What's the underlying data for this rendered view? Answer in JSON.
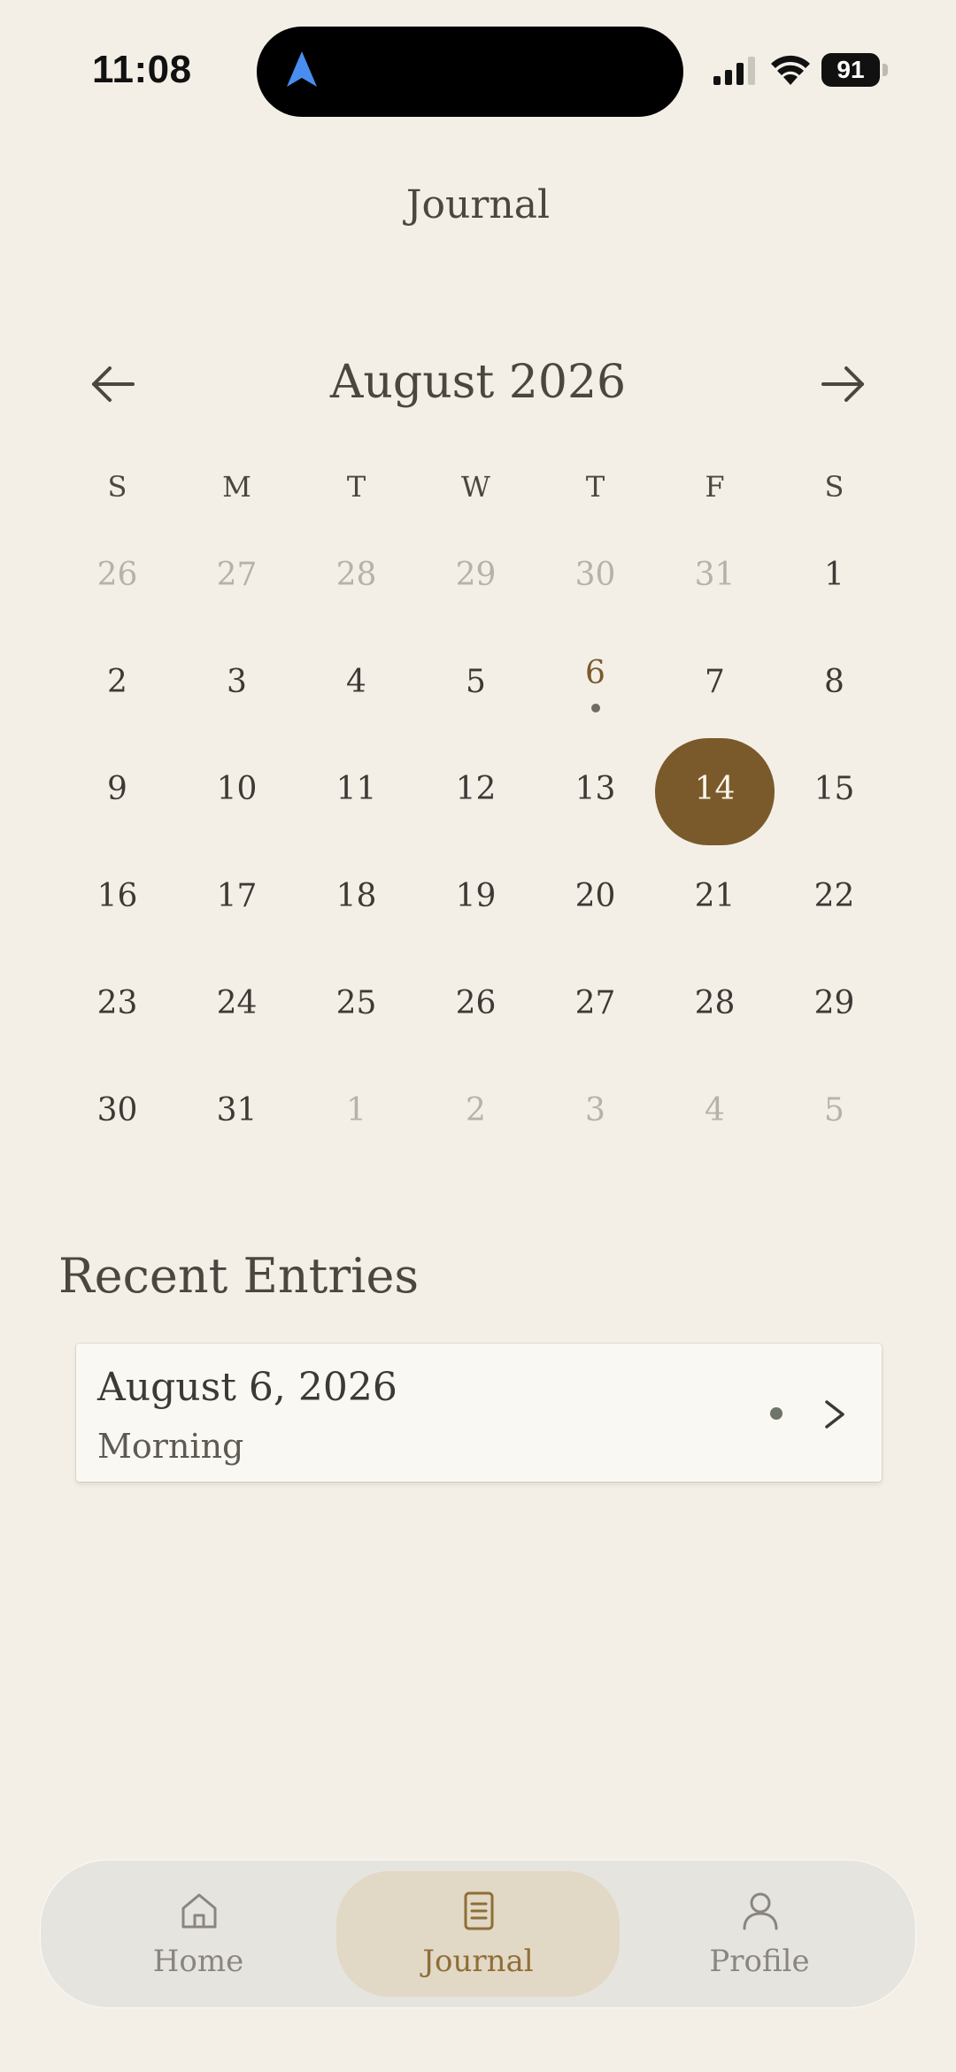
{
  "status_bar": {
    "time": "11:08",
    "battery": "91"
  },
  "header": {
    "title": "Journal"
  },
  "calendar": {
    "month_label": "August 2026",
    "weekdays": [
      "S",
      "M",
      "T",
      "W",
      "T",
      "F",
      "S"
    ],
    "days": [
      {
        "label": "26",
        "muted": true
      },
      {
        "label": "27",
        "muted": true
      },
      {
        "label": "28",
        "muted": true
      },
      {
        "label": "29",
        "muted": true
      },
      {
        "label": "30",
        "muted": true
      },
      {
        "label": "31",
        "muted": true
      },
      {
        "label": "1"
      },
      {
        "label": "2"
      },
      {
        "label": "3"
      },
      {
        "label": "4"
      },
      {
        "label": "5"
      },
      {
        "label": "6",
        "has_entry": true
      },
      {
        "label": "7"
      },
      {
        "label": "8"
      },
      {
        "label": "9"
      },
      {
        "label": "10"
      },
      {
        "label": "11"
      },
      {
        "label": "12"
      },
      {
        "label": "13"
      },
      {
        "label": "14",
        "selected": true
      },
      {
        "label": "15"
      },
      {
        "label": "16"
      },
      {
        "label": "17"
      },
      {
        "label": "18"
      },
      {
        "label": "19"
      },
      {
        "label": "20"
      },
      {
        "label": "21"
      },
      {
        "label": "22"
      },
      {
        "label": "23"
      },
      {
        "label": "24"
      },
      {
        "label": "25"
      },
      {
        "label": "26"
      },
      {
        "label": "27"
      },
      {
        "label": "28"
      },
      {
        "label": "29"
      },
      {
        "label": "30"
      },
      {
        "label": "31"
      },
      {
        "label": "1",
        "muted": true
      },
      {
        "label": "2",
        "muted": true
      },
      {
        "label": "3",
        "muted": true
      },
      {
        "label": "4",
        "muted": true
      },
      {
        "label": "5",
        "muted": true
      }
    ]
  },
  "recent_entries": {
    "title": "Recent Entries",
    "items": [
      {
        "date": "August 6, 2026",
        "time_of_day": "Morning"
      }
    ]
  },
  "tab_bar": {
    "tabs": [
      {
        "label": "Home",
        "icon": "home-icon",
        "active": false
      },
      {
        "label": "Journal",
        "icon": "journal-icon",
        "active": true
      },
      {
        "label": "Profile",
        "icon": "profile-icon",
        "active": false
      }
    ]
  },
  "colors": {
    "background": "#f3efe7",
    "accent": "#7a5a2a",
    "tab_active_bg": "#e2d8c6",
    "tab_active_text": "#8f6e37",
    "muted_text": "#b7b1a8"
  }
}
